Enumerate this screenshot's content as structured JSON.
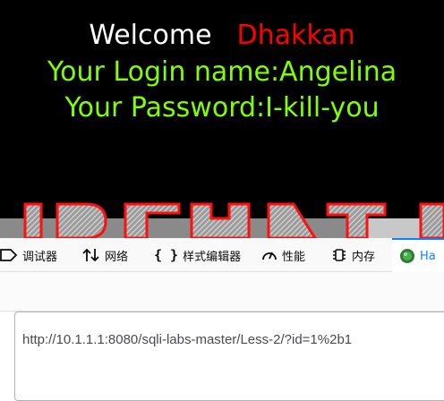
{
  "page": {
    "welcome_word": "Welcome",
    "welcome_name": "Dhakkan",
    "login_name_line": "Your Login name:Angelina",
    "password_line": "Your Password:I-kill-you"
  },
  "devtools": {
    "tabs": [
      {
        "label": "调试器",
        "icon": "debugger-icon"
      },
      {
        "label": "网络",
        "icon": "network-icon"
      },
      {
        "label": "样式编辑器",
        "icon": "style-editor-icon"
      },
      {
        "label": "性能",
        "icon": "performance-icon"
      },
      {
        "label": "内存",
        "icon": "memory-icon"
      },
      {
        "label": "Ha",
        "icon": "hackbar-icon"
      }
    ],
    "url_value": "http://10.1.1.1:8080/sqli-labs-master/Less-2/?id=1%2b1"
  },
  "colors": {
    "page_background": "#000000",
    "welcome_word": "#ffffff",
    "welcome_name": "#ff0000",
    "login_text": "#7fff00",
    "active_tab_accent": "#0a84ff"
  }
}
